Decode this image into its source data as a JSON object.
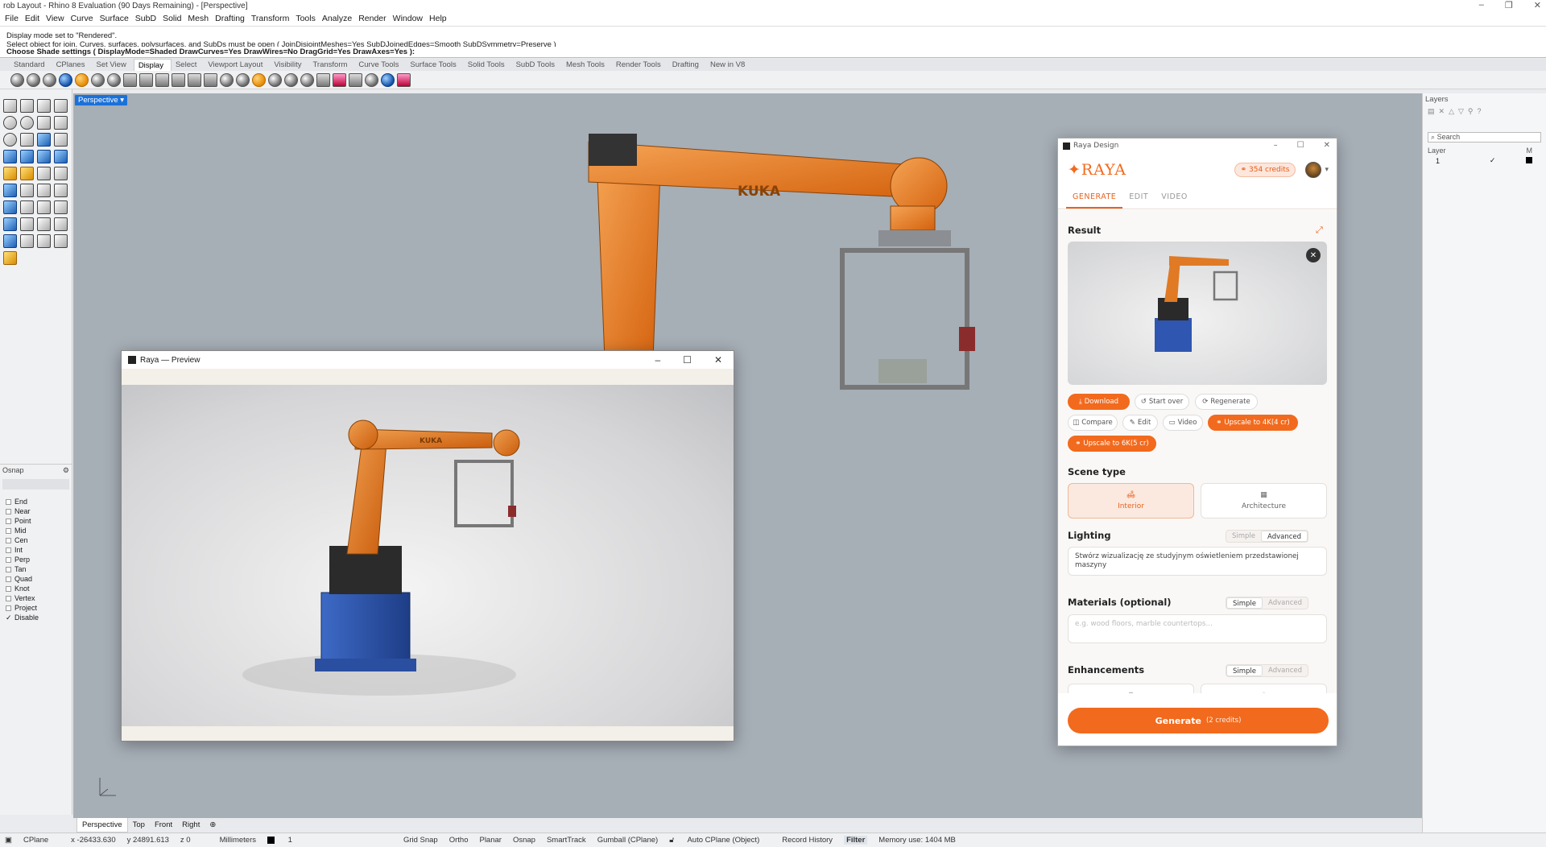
{
  "window": {
    "title": "rob Layout - Rhino 8 Evaluation (90 Days Remaining) - [Perspective]",
    "controls": [
      "–",
      "❐",
      "✕"
    ]
  },
  "menu": [
    "File",
    "Edit",
    "View",
    "Curve",
    "Surface",
    "SubD",
    "Solid",
    "Mesh",
    "Drafting",
    "Transform",
    "Tools",
    "Analyze",
    "Render",
    "Window",
    "Help"
  ],
  "command": {
    "history": [
      "Display mode set to \"Rendered\".",
      "Select object for join. Curves, surfaces, polysurfaces, and SubDs must be open ( JoinDisjointMeshes=Yes  SubDJoinedEdges=Smooth  SubDSymmetry=Preserve )"
    ],
    "prompt": "Choose Shade settings ( DisplayMode=Shaded  DrawCurves=Yes  DrawWires=No  DragGrid=Yes  DrawAxes=Yes ):"
  },
  "toolbar_tabs": [
    "Standard",
    "CPlanes",
    "Set View",
    "Display",
    "Select",
    "Viewport Layout",
    "Visibility",
    "Transform",
    "Curve Tools",
    "Surface Tools",
    "Solid Tools",
    "SubD Tools",
    "Mesh Tools",
    "Render Tools",
    "Drafting",
    "New in V8"
  ],
  "active_toolbar_tab": "Display",
  "osnap": {
    "title": "Osnap",
    "items": [
      "End",
      "Near",
      "Point",
      "Mid",
      "Cen",
      "Int",
      "Perp",
      "Tan",
      "Quad",
      "Knot",
      "Vertex",
      "Project",
      "Disable"
    ],
    "checked": "Disable"
  },
  "viewport": {
    "label": "Perspective",
    "robot_brand": "KUKA",
    "axes": {
      "x": "x",
      "y": "y",
      "z": "z"
    }
  },
  "view_tabs": [
    "Perspective",
    "Top",
    "Front",
    "Right"
  ],
  "status": {
    "cplane": "CPlane",
    "x": "x -26433.630",
    "y": "y 24891.613",
    "z": "z 0",
    "units": "Millimeters",
    "layer": "1",
    "toggles": [
      "Grid Snap",
      "Ortho",
      "Planar",
      "Osnap",
      "SmartTrack",
      "Gumball (CPlane)",
      "Auto CPlane (Object)",
      "Record History",
      "Filter"
    ],
    "memory": "Memory use: 1404 MB"
  },
  "layers": {
    "title": "Layers",
    "search_placeholder": "Search",
    "column": "Layer",
    "column_m": "M",
    "rows": [
      {
        "name": "1"
      }
    ]
  },
  "preview": {
    "title": "Raya — Preview",
    "brand": "KUKA"
  },
  "raya": {
    "title": "Raya Design",
    "logo": "RAYA",
    "credits": "354 credits",
    "tabs": [
      "GENERATE",
      "EDIT",
      "VIDEO"
    ],
    "active_tab": "GENERATE",
    "result_heading": "Result",
    "actions": {
      "download": "Download",
      "start_over": "Start over",
      "regenerate": "Regenerate",
      "compare": "Compare",
      "edit": "Edit",
      "video": "Video",
      "upscale4k": "Upscale to 4K(4 cr)",
      "upscale6k": "Upscale to 6K(5 cr)"
    },
    "scene_type": {
      "heading": "Scene type",
      "options": [
        "Interior",
        "Architecture"
      ],
      "selected": "Interior"
    },
    "lighting": {
      "heading": "Lighting",
      "modes": [
        "Simple",
        "Advanced"
      ],
      "mode": "Advanced",
      "value": "Stwórz wizualizację ze studyjnym oświetleniem przedstawionej maszyny"
    },
    "materials": {
      "heading": "Materials (optional)",
      "modes": [
        "Simple",
        "Advanced"
      ],
      "mode": "Simple",
      "placeholder": "e.g. wood floors, marble countertops..."
    },
    "enhancements": {
      "heading": "Enhancements",
      "modes": [
        "Simple",
        "Advanced"
      ],
      "mode": "Simple"
    },
    "generate": {
      "label": "Generate",
      "cost": "(2 credits)"
    }
  }
}
